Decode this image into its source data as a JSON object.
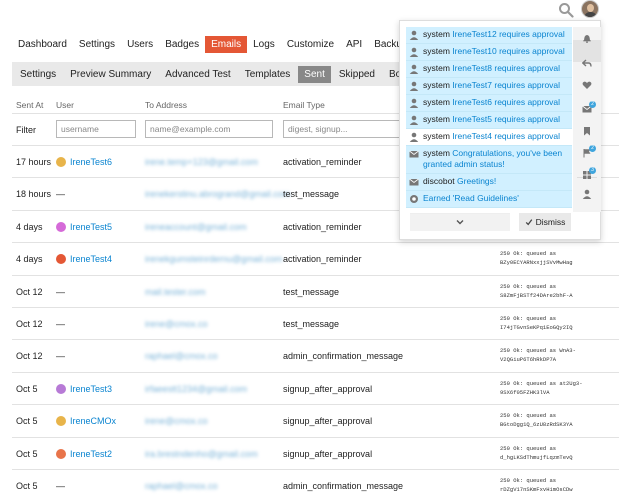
{
  "topbar": {
    "search_icon": "search-icon",
    "avatar_icon": "user-avatar"
  },
  "admin_nav": [
    {
      "label": "Dashboard",
      "active": false
    },
    {
      "label": "Settings",
      "active": false
    },
    {
      "label": "Users",
      "active": false
    },
    {
      "label": "Badges",
      "active": false
    },
    {
      "label": "Emails",
      "active": true
    },
    {
      "label": "Logs",
      "active": false
    },
    {
      "label": "Customize",
      "active": false
    },
    {
      "label": "API",
      "active": false
    },
    {
      "label": "Backup",
      "active": false
    }
  ],
  "sub_nav": [
    {
      "label": "Settings",
      "active": false
    },
    {
      "label": "Preview Summary",
      "active": false
    },
    {
      "label": "Advanced Test",
      "active": false
    },
    {
      "label": "Templates",
      "active": false
    },
    {
      "label": "Sent",
      "active": true
    },
    {
      "label": "Skipped",
      "active": false
    },
    {
      "label": "Bounc",
      "active": false
    }
  ],
  "table": {
    "headers": {
      "sent_at": "Sent At",
      "user": "User",
      "to_address": "To Address",
      "email_type": "Email Type"
    },
    "filter": {
      "label": "Filter",
      "user_placeholder": "username",
      "to_placeholder": "name@example.com",
      "type_placeholder": "digest, signup..."
    },
    "rows": [
      {
        "sent": "17 hours",
        "user": "IreneTest6",
        "avatar_color": "#e8b44a",
        "to": "irene.temp+123@gmail.com",
        "type": "activation_reminder",
        "reply": [
          "",
          ""
        ]
      },
      {
        "sent": "18 hours",
        "user": "—",
        "avatar_color": "",
        "to": "irenekerstinu.abrogrand@gmail.com",
        "type": "test_message",
        "reply": [
          "",
          ""
        ]
      },
      {
        "sent": "4 days",
        "user": "IreneTest5",
        "avatar_color": "#d56ad8",
        "to": "ireneaccount@gmail.com",
        "type": "activation_reminder",
        "reply": [
          "",
          ""
        ]
      },
      {
        "sent": "4 days",
        "user": "IreneTest4",
        "avatar_color": "#e45735",
        "to": "irenekgumsteinrdernu@gmail.com",
        "type": "activation_reminder",
        "reply": [
          "250 Ok: queued as",
          "BZy0ECYARNxxjjSVvMwHag"
        ]
      },
      {
        "sent": "Oct 12",
        "user": "—",
        "avatar_color": "",
        "to": "mail.tester.com",
        "type": "test_message",
        "reply": [
          "250 Ok: queued as",
          "S8ZmFjBSTf24DAre2bhF-A"
        ]
      },
      {
        "sent": "Oct 12",
        "user": "—",
        "avatar_color": "",
        "to": "irene@cmox.co",
        "type": "test_message",
        "reply": [
          "250 Ok: queued as",
          "I74jTGvnSeKPq1EoGQy2IQ"
        ]
      },
      {
        "sent": "Oct 12",
        "user": "—",
        "avatar_color": "",
        "to": "raphael@cmox.co",
        "type": "admin_confirmation_message",
        "reply": [
          "250 Ok: queued as WnA3-",
          "V2QGiuP6T6hRkDP7A"
        ]
      },
      {
        "sent": "Oct 5",
        "user": "IreneTest3",
        "avatar_color": "#b77ad6",
        "to": "irfaeestt1234@gmail.com",
        "type": "signup_after_approval",
        "reply": [
          "250 Ok: queued as at2Ug3-",
          "9SX6f05FZHK3lVA"
        ]
      },
      {
        "sent": "Oct 5",
        "user": "IreneCMOx",
        "avatar_color": "#e8b44a",
        "to": "irene@cmox.co",
        "type": "signup_after_approval",
        "reply": [
          "250 Ok: queued as",
          "BGtoDgg1Q_6zU8zRdSK3YA"
        ]
      },
      {
        "sent": "Oct 5",
        "user": "IreneTest2",
        "avatar_color": "#e8744a",
        "to": "ira.brestndenho@gmail.com",
        "type": "signup_after_approval",
        "reply": [
          "250 Ok: queued as",
          "d_hgLKSdThmujfLqzmTevQ"
        ]
      },
      {
        "sent": "Oct 5",
        "user": "—",
        "avatar_color": "",
        "to": "raphael@cmox.co",
        "type": "admin_confirmation_message",
        "reply": [
          "250 Ok: queued as",
          "rDZgV17nSKmFxvHimOsCDw"
        ]
      }
    ]
  },
  "notifications": {
    "items": [
      {
        "icon": "user-icon",
        "actor": "system",
        "link": "IreneTest12",
        "text": "requires approval",
        "read": false
      },
      {
        "icon": "user-icon",
        "actor": "system",
        "link": "IreneTest10",
        "text": "requires approval",
        "read": false
      },
      {
        "icon": "user-icon",
        "actor": "system",
        "link": "IreneTest8",
        "text": "requires approval",
        "read": false
      },
      {
        "icon": "user-icon",
        "actor": "system",
        "link": "IreneTest7",
        "text": "requires approval",
        "read": false
      },
      {
        "icon": "user-icon",
        "actor": "system",
        "link": "IreneTest6",
        "text": "requires approval",
        "read": false
      },
      {
        "icon": "user-icon",
        "actor": "system",
        "link": "IreneTest5",
        "text": "requires approval",
        "read": false
      },
      {
        "icon": "user-icon",
        "actor": "system",
        "link": "IreneTest4",
        "text": "requires approval",
        "read": true
      },
      {
        "icon": "envelope-icon",
        "actor": "system",
        "link": "Congratulations, you've been granted admin status!",
        "text": "",
        "read": false
      },
      {
        "icon": "envelope-icon",
        "actor": "discobot",
        "link": "Greetings!",
        "text": "",
        "read": false
      },
      {
        "icon": "badge-icon",
        "actor": "",
        "link": "Earned 'Read Guidelines'",
        "text": "",
        "read": false
      }
    ],
    "dismiss_label": "Dismiss",
    "rail": [
      {
        "icon": "bell-icon",
        "badge": ""
      },
      {
        "icon": "reply-icon",
        "badge": ""
      },
      {
        "icon": "heart-icon",
        "badge": ""
      },
      {
        "icon": "envelope-icon",
        "badge": "2"
      },
      {
        "icon": "bookmark-icon",
        "badge": ""
      },
      {
        "icon": "flag-icon",
        "badge": "2"
      },
      {
        "icon": "grid-icon",
        "badge": "3"
      },
      {
        "icon": "user-icon",
        "badge": ""
      }
    ],
    "accent": "#d1f0ff"
  }
}
